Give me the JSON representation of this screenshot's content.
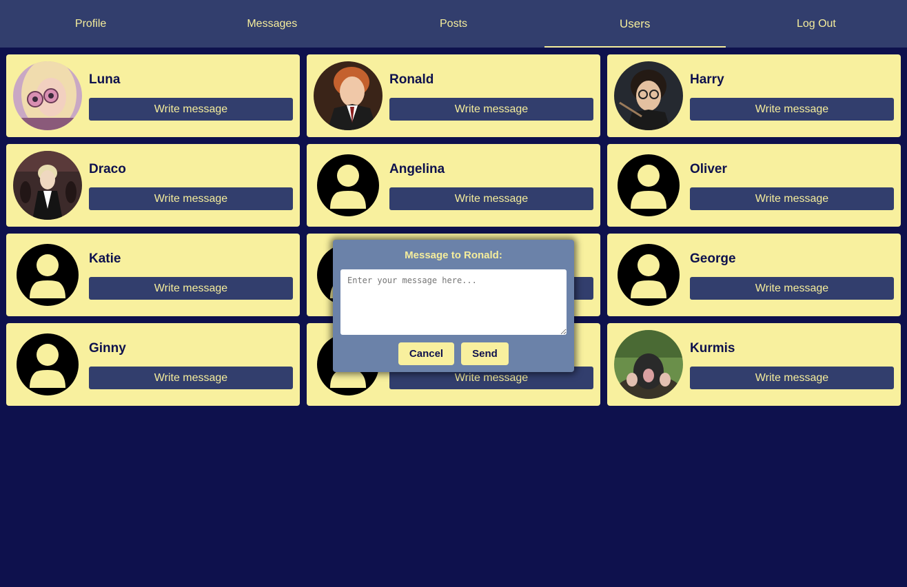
{
  "nav": {
    "items": [
      {
        "label": "Profile",
        "name": "nav-profile",
        "active": false
      },
      {
        "label": "Messages",
        "name": "nav-messages",
        "active": false
      },
      {
        "label": "Posts",
        "name": "nav-posts",
        "active": false
      },
      {
        "label": "Users",
        "name": "nav-users",
        "active": true
      },
      {
        "label": "Log Out",
        "name": "nav-logout",
        "active": false
      }
    ]
  },
  "users": [
    {
      "name": "Luna",
      "avatar": "photo-blonde-girl"
    },
    {
      "name": "Ronald",
      "avatar": "photo-red-hair-boy"
    },
    {
      "name": "Harry",
      "avatar": "photo-dark-hair-boy"
    },
    {
      "name": "Draco",
      "avatar": "photo-blond-boy"
    },
    {
      "name": "Angelina",
      "avatar": "default-user-icon"
    },
    {
      "name": "Oliver",
      "avatar": "default-user-icon"
    },
    {
      "name": "Katie",
      "avatar": "default-user-icon"
    },
    {
      "name": "",
      "avatar": "default-user-icon"
    },
    {
      "name": "George",
      "avatar": "default-user-icon"
    },
    {
      "name": "Ginny",
      "avatar": "default-user-icon"
    },
    {
      "name": "",
      "avatar": "default-user-icon"
    },
    {
      "name": "Kurmis",
      "avatar": "photo-mole"
    }
  ],
  "card": {
    "write_label": "Write message"
  },
  "modal": {
    "title": "Message to Ronald:",
    "placeholder": "Enter your message here...",
    "value": "",
    "cancel_label": "Cancel",
    "send_label": "Send"
  },
  "colors": {
    "background": "#0e114d",
    "nav": "#323e6d",
    "card": "#f8f09e",
    "accent_text": "#f5ed9c",
    "modal": "#6b82a9"
  }
}
